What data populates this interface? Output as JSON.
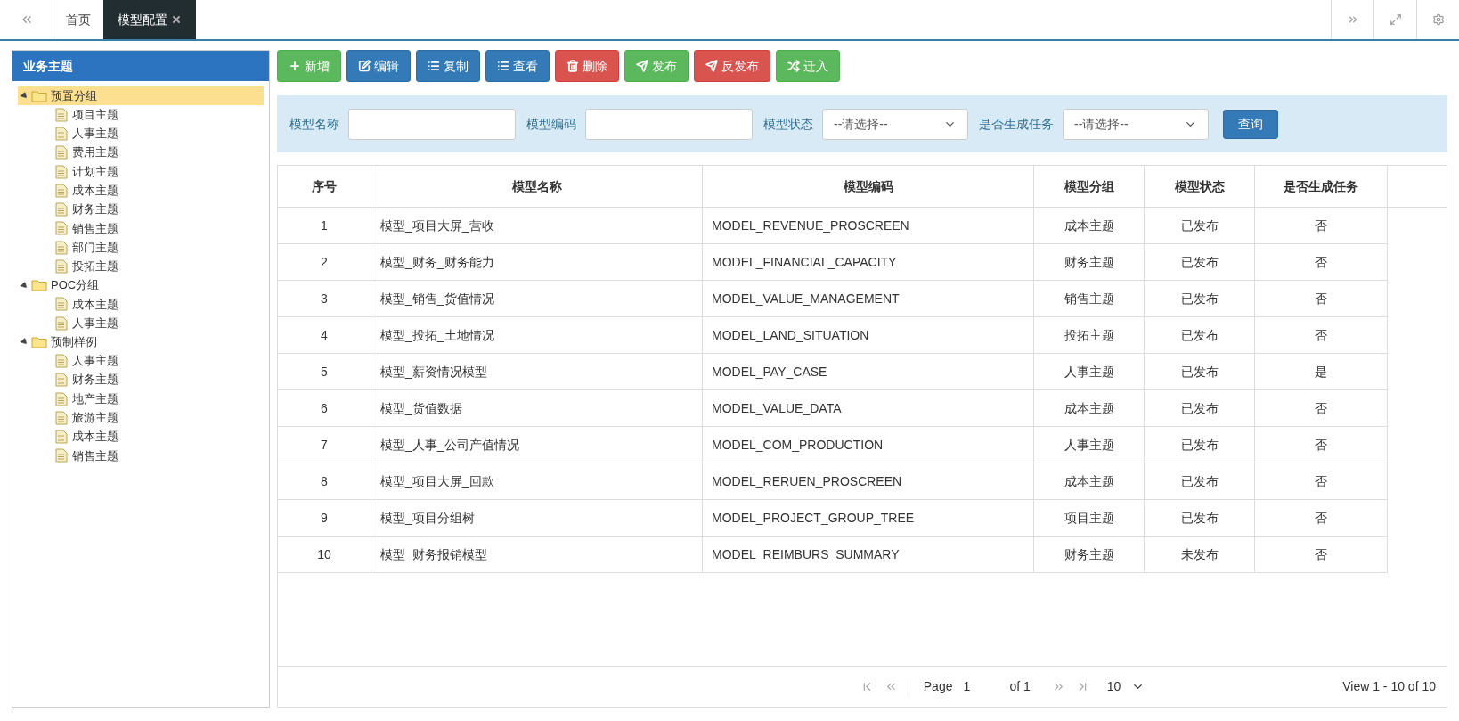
{
  "tabs": [
    {
      "label": "首页",
      "selected": false
    },
    {
      "label": "模型配置",
      "selected": true
    }
  ],
  "sidebar": {
    "title": "业务主题",
    "tree": [
      {
        "label": "预置分组",
        "selected": true,
        "expanded": true,
        "children": [
          {
            "label": "项目主题"
          },
          {
            "label": "人事主题"
          },
          {
            "label": "费用主题"
          },
          {
            "label": "计划主题"
          },
          {
            "label": "成本主题"
          },
          {
            "label": "财务主题"
          },
          {
            "label": "销售主题"
          },
          {
            "label": "部门主题"
          },
          {
            "label": "投拓主题"
          }
        ]
      },
      {
        "label": "POC分组",
        "selected": false,
        "expanded": true,
        "children": [
          {
            "label": "成本主题"
          },
          {
            "label": "人事主题"
          }
        ]
      },
      {
        "label": "预制样例",
        "selected": false,
        "expanded": true,
        "children": [
          {
            "label": "人事主题"
          },
          {
            "label": "财务主题"
          },
          {
            "label": "地产主题"
          },
          {
            "label": "旅游主题"
          },
          {
            "label": "成本主题"
          },
          {
            "label": "销售主题"
          }
        ]
      }
    ]
  },
  "toolbar": [
    {
      "label": "新增",
      "kind": "success"
    },
    {
      "label": "编辑",
      "kind": "primary"
    },
    {
      "label": "复制",
      "kind": "primary"
    },
    {
      "label": "查看",
      "kind": "primary"
    },
    {
      "label": "删除",
      "kind": "danger"
    },
    {
      "label": "发布",
      "kind": "success"
    },
    {
      "label": "反发布",
      "kind": "danger"
    },
    {
      "label": "迁入",
      "kind": "success"
    }
  ],
  "filters": {
    "fields": [
      {
        "label": "模型名称",
        "kind": "text"
      },
      {
        "label": "模型编码",
        "kind": "text"
      },
      {
        "label": "模型状态",
        "kind": "select",
        "value": "--请选择--"
      },
      {
        "label": "是否生成任务",
        "kind": "select",
        "value": "--请选择--"
      }
    ],
    "button": "查询"
  },
  "table": {
    "columns": [
      "序号",
      "模型名称",
      "模型编码",
      "模型分组",
      "模型状态",
      "是否生成任务"
    ],
    "rows": [
      [
        "1",
        "模型_项目大屏_营收",
        "MODEL_REVENUE_PROSCREEN",
        "成本主题",
        "已发布",
        "否"
      ],
      [
        "2",
        "模型_财务_财务能力",
        "MODEL_FINANCIAL_CAPACITY",
        "财务主题",
        "已发布",
        "否"
      ],
      [
        "3",
        "模型_销售_货值情况",
        "MODEL_VALUE_MANAGEMENT",
        "销售主题",
        "已发布",
        "否"
      ],
      [
        "4",
        "模型_投拓_土地情况",
        "MODEL_LAND_SITUATION",
        "投拓主题",
        "已发布",
        "否"
      ],
      [
        "5",
        "模型_薪资情况模型",
        "MODEL_PAY_CASE",
        "人事主题",
        "已发布",
        "是"
      ],
      [
        "6",
        "模型_货值数据",
        "MODEL_VALUE_DATA",
        "成本主题",
        "已发布",
        "否"
      ],
      [
        "7",
        "模型_人事_公司产值情况",
        "MODEL_COM_PRODUCTION",
        "人事主题",
        "已发布",
        "否"
      ],
      [
        "8",
        "模型_项目大屏_回款",
        "MODEL_RERUEN_PROSCREEN",
        "成本主题",
        "已发布",
        "否"
      ],
      [
        "9",
        "模型_项目分组树",
        "MODEL_PROJECT_GROUP_TREE",
        "项目主题",
        "已发布",
        "否"
      ],
      [
        "10",
        "模型_财务报销模型",
        "MODEL_REIMBURS_SUMMARY",
        "财务主题",
        "未发布",
        "否"
      ]
    ]
  },
  "pager": {
    "page_label": "Page",
    "page": "1",
    "of": "of 1",
    "page_size": "10",
    "summary": "View 1 - 10 of 10"
  }
}
